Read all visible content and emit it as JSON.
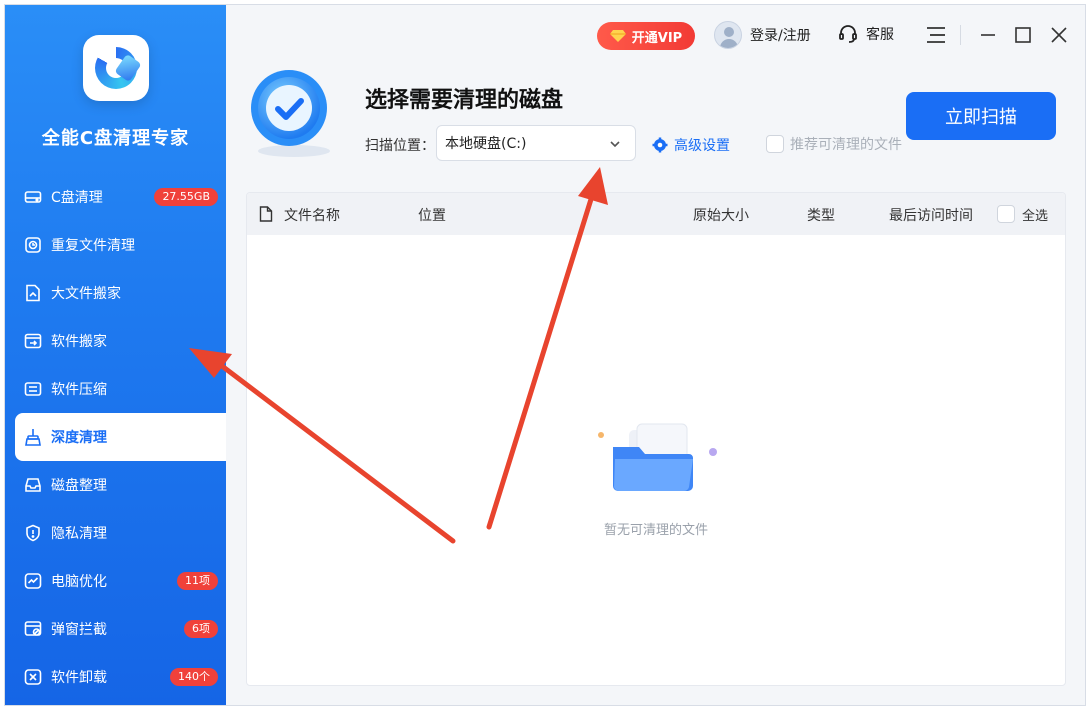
{
  "app": {
    "title": "全能C盘清理专家"
  },
  "colors": {
    "accent": "#1a6ef5",
    "sidebar": "#1f7bf0",
    "badge": "#f0413a",
    "arrow": "#e8442e"
  },
  "topbar": {
    "vip_label": "开通VIP",
    "login_label": "登录/注册",
    "service_label": "客服"
  },
  "sidebar": {
    "items": [
      {
        "label": "C盘清理",
        "badge": "27.55GB",
        "icon": "drive-icon"
      },
      {
        "label": "重复文件清理",
        "badge": "",
        "icon": "duplicate-icon"
      },
      {
        "label": "大文件搬家",
        "badge": "",
        "icon": "file-move-icon"
      },
      {
        "label": "软件搬家",
        "badge": "",
        "icon": "app-move-icon"
      },
      {
        "label": "软件压缩",
        "badge": "",
        "icon": "compress-icon"
      },
      {
        "label": "深度清理",
        "badge": "",
        "icon": "broom-icon",
        "active": true
      },
      {
        "label": "磁盘整理",
        "badge": "",
        "icon": "inbox-icon"
      },
      {
        "label": "隐私清理",
        "badge": "",
        "icon": "shield-icon"
      },
      {
        "label": "电脑优化",
        "badge": "11项",
        "icon": "chart-icon"
      },
      {
        "label": "弹窗拦截",
        "badge": "6项",
        "icon": "popup-icon"
      },
      {
        "label": "软件卸载",
        "badge": "140个",
        "icon": "uninstall-icon"
      }
    ]
  },
  "main": {
    "heading": "选择需要清理的磁盘",
    "scan_location_label": "扫描位置：",
    "scan_location_value": "本地硬盘(C:)",
    "advanced_settings": "高级设置",
    "recommend_label": "推荐可清理的文件",
    "scan_button": "立即扫描"
  },
  "table": {
    "columns": [
      "文件名称",
      "位置",
      "原始大小",
      "类型",
      "最后访问时间"
    ],
    "select_all": "全选",
    "empty_text": "暂无可清理的文件",
    "rows": []
  }
}
